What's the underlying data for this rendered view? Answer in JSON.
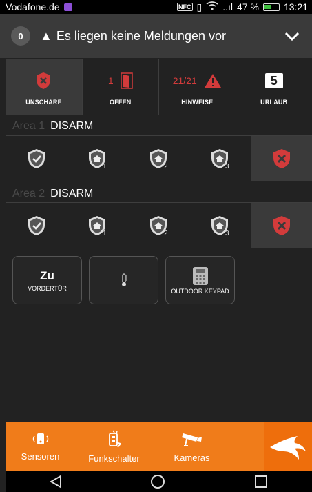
{
  "statusbar": {
    "carrier": "Vodafone.de",
    "nfc": "NFC",
    "signal": "..ıl",
    "battery_pct": "47 %",
    "time": "13:21"
  },
  "header": {
    "count": "0",
    "message": "Es liegen keine Meldungen vor"
  },
  "tiles": [
    {
      "value": "",
      "label": "UNSCHARF"
    },
    {
      "value": "1",
      "label": "OFFEN"
    },
    {
      "value": "21/21",
      "label": "HINWEISE"
    },
    {
      "value": "5",
      "label": "URLAUB"
    }
  ],
  "areas": [
    {
      "name": "Area 1",
      "state": "DISARM"
    },
    {
      "name": "Area 2",
      "state": "DISARM"
    }
  ],
  "cards": [
    {
      "big": "Zu",
      "label": "VORDERTÜR"
    },
    {
      "big": "",
      "label": ""
    },
    {
      "big": "",
      "label": "OUTDOOR KEYPAD"
    }
  ],
  "nav": {
    "sensors": "Sensoren",
    "switch": "Funkschalter",
    "cameras": "Kameras"
  },
  "colors": {
    "accent": "#f07c1a",
    "alert": "#d23b3b",
    "background": "#222222"
  }
}
